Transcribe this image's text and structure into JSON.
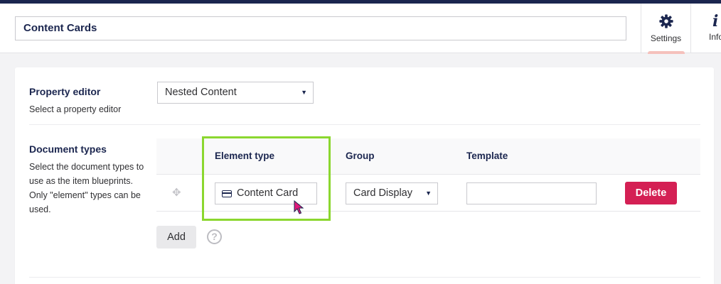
{
  "header": {
    "name_value": "Content Cards",
    "apps": [
      {
        "label": "Settings",
        "icon": "gear-icon",
        "active": true,
        "active_color": "#f5c1bc"
      },
      {
        "label": "Info",
        "icon": "info-icon"
      }
    ]
  },
  "property_editor": {
    "label": "Property editor",
    "description": "Select a property editor",
    "selected": "Nested Content"
  },
  "document_types": {
    "label": "Document types",
    "description": "Select the document types to use as the item blueprints. Only \"element\" types can be used.",
    "columns": [
      "Element type",
      "Group",
      "Template"
    ],
    "rows": [
      {
        "element_type": "Content Card",
        "group": "Card Display",
        "template": "",
        "delete_label": "Delete"
      }
    ],
    "add_label": "Add",
    "help_glyph": "?"
  },
  "colors": {
    "brand_navy": "#1b264f",
    "delete_button": "#d42054",
    "highlight_box": "#8bd72f",
    "cursor": "#e0197a"
  }
}
